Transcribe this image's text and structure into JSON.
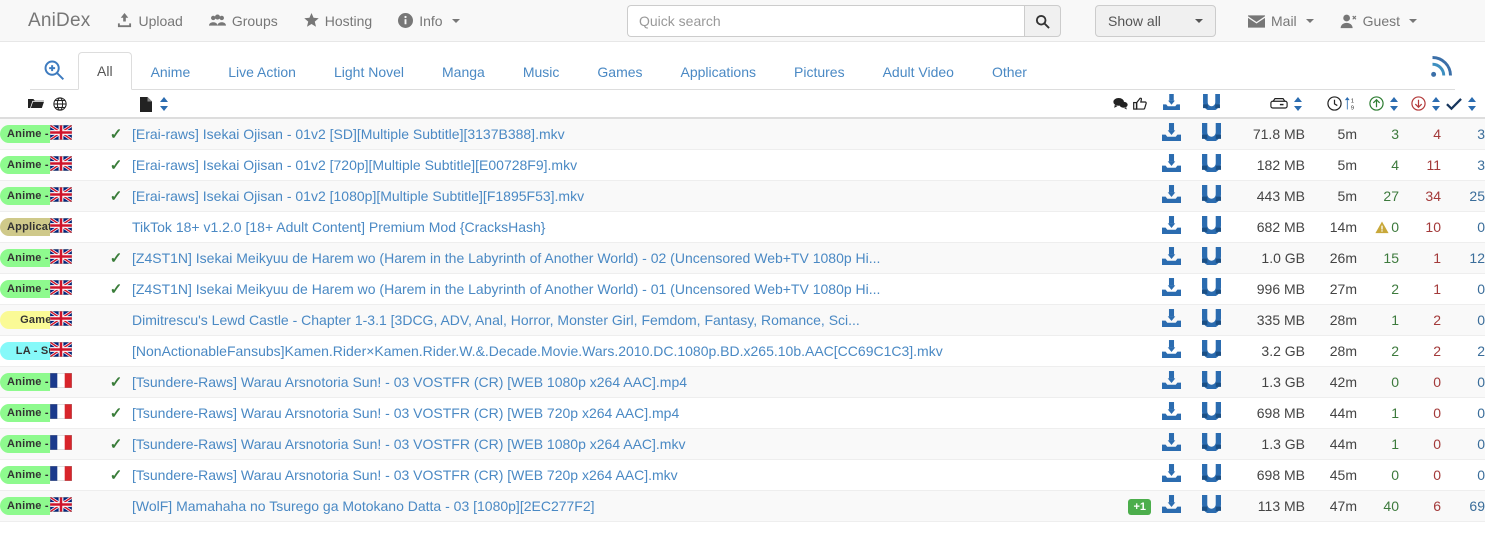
{
  "navbar": {
    "brand": "AniDex",
    "links": [
      {
        "label": "Upload",
        "icon": "upload-icon",
        "caret": false
      },
      {
        "label": "Groups",
        "icon": "users-icon",
        "caret": false
      },
      {
        "label": "Hosting",
        "icon": "star-icon",
        "caret": false
      },
      {
        "label": "Info",
        "icon": "info-icon",
        "caret": true
      }
    ],
    "search": {
      "placeholder": "Quick search",
      "value": "",
      "button_icon": "search-icon"
    },
    "filter": {
      "label": "Show all"
    },
    "right_links": [
      {
        "label": "Mail",
        "icon": "envelope-icon",
        "caret": true
      },
      {
        "label": "Guest",
        "icon": "user-icon",
        "caret": true
      }
    ]
  },
  "tabs": {
    "zoom_icon": "search-plus-icon",
    "rss_icon": "rss-icon",
    "items": [
      {
        "label": "All",
        "active": true
      },
      {
        "label": "Anime",
        "active": false
      },
      {
        "label": "Live Action",
        "active": false
      },
      {
        "label": "Light Novel",
        "active": false
      },
      {
        "label": "Manga",
        "active": false
      },
      {
        "label": "Music",
        "active": false
      },
      {
        "label": "Games",
        "active": false
      },
      {
        "label": "Applications",
        "active": false
      },
      {
        "label": "Pictures",
        "active": false
      },
      {
        "label": "Adult Video",
        "active": false
      },
      {
        "label": "Other",
        "active": false
      }
    ]
  },
  "table": {
    "headers": {
      "category_icon": "folder-open-icon",
      "language_icon": "globe-icon",
      "filename_icon": "file-icon",
      "comments_icon": "comments-icon",
      "likes_icon": "thumbs-up-icon",
      "download_icon": "download-icon",
      "magnet_icon": "magnet-icon",
      "size_icon": "hdd-icon",
      "age_icon": "clock-icon",
      "age_sort_icon": "sort-numeric-icon",
      "seeders_icon": "arrow-up-circle-icon",
      "leechers_icon": "arrow-down-circle-icon",
      "completed_icon": "check-icon"
    },
    "colors": {
      "anime_sub": "#8efa8e",
      "applications": "#cfc98a",
      "games": "#fafa96",
      "la_sub": "#86f9f9",
      "seeders": "#3d7a3d",
      "leechers": "#a33a3a",
      "completed": "#3a6d9a",
      "comment_badge": "#4cae4c",
      "link": "#4a89c4"
    },
    "rows": [
      {
        "category": "Anime - Sub",
        "cat_color": "#8efa8e",
        "flag": "gb",
        "verified": true,
        "title": "[Erai-raws] Isekai Ojisan - 01v2 [SD][Multiple Subtitle][3137B388].mkv",
        "comments": "",
        "size": "71.8 MB",
        "age": "5m",
        "seeders": "3",
        "leechers": "4",
        "completed": "3",
        "warning": false
      },
      {
        "category": "Anime - Sub",
        "cat_color": "#8efa8e",
        "flag": "gb",
        "verified": true,
        "title": "[Erai-raws] Isekai Ojisan - 01v2 [720p][Multiple Subtitle][E00728F9].mkv",
        "comments": "",
        "size": "182 MB",
        "age": "5m",
        "seeders": "4",
        "leechers": "11",
        "completed": "3",
        "warning": false
      },
      {
        "category": "Anime - Sub",
        "cat_color": "#8efa8e",
        "flag": "gb",
        "verified": true,
        "title": "[Erai-raws] Isekai Ojisan - 01v2 [1080p][Multiple Subtitle][F1895F53].mkv",
        "comments": "",
        "size": "443 MB",
        "age": "5m",
        "seeders": "27",
        "leechers": "34",
        "completed": "25",
        "warning": false
      },
      {
        "category": "Applications",
        "cat_color": "#cfc98a",
        "flag": "gb",
        "verified": false,
        "title": "TikTok 18+ v1.2.0 [18+ Adult Content] Premium Mod {CracksHash}",
        "comments": "",
        "size": "682 MB",
        "age": "14m",
        "seeders": "0",
        "leechers": "10",
        "completed": "0",
        "warning": true
      },
      {
        "category": "Anime - Sub",
        "cat_color": "#8efa8e",
        "flag": "gb",
        "verified": true,
        "title": "[Z4ST1N] Isekai Meikyuu de Harem wo (Harem in the Labyrinth of Another World) - 02 (Uncensored Web+TV 1080p Hi...",
        "comments": "",
        "size": "1.0 GB",
        "age": "26m",
        "seeders": "15",
        "leechers": "1",
        "completed": "12",
        "warning": false
      },
      {
        "category": "Anime - Sub",
        "cat_color": "#8efa8e",
        "flag": "gb",
        "verified": true,
        "title": "[Z4ST1N] Isekai Meikyuu de Harem wo (Harem in the Labyrinth of Another World) - 01 (Uncensored Web+TV 1080p Hi...",
        "comments": "",
        "size": "996 MB",
        "age": "27m",
        "seeders": "2",
        "leechers": "1",
        "completed": "0",
        "warning": false
      },
      {
        "category": "Games",
        "cat_color": "#fafa96",
        "flag": "gb",
        "verified": false,
        "title": "Dimitrescu's Lewd Castle - Chapter 1-3.1 [3DCG, ADV, Anal, Horror, Monster Girl, Femdom, Fantasy, Romance, Sci...",
        "comments": "",
        "size": "335 MB",
        "age": "28m",
        "seeders": "1",
        "leechers": "2",
        "completed": "0",
        "warning": false
      },
      {
        "category": "LA - Sub",
        "cat_color": "#86f9f9",
        "flag": "gb",
        "verified": false,
        "title": "[NonActionableFansubs]Kamen.Rider×Kamen.Rider.W.&.Decade.Movie.Wars.2010.DC.1080p.BD.x265.10b.AAC[CC69C1C3].mkv",
        "comments": "",
        "size": "3.2 GB",
        "age": "28m",
        "seeders": "2",
        "leechers": "2",
        "completed": "2",
        "warning": false
      },
      {
        "category": "Anime - Sub",
        "cat_color": "#8efa8e",
        "flag": "fr",
        "verified": true,
        "title": "[Tsundere-Raws] Warau Arsnotoria Sun! - 03 VOSTFR (CR) [WEB 1080p x264 AAC].mp4",
        "comments": "",
        "size": "1.3 GB",
        "age": "42m",
        "seeders": "0",
        "leechers": "0",
        "completed": "0",
        "warning": false
      },
      {
        "category": "Anime - Sub",
        "cat_color": "#8efa8e",
        "flag": "fr",
        "verified": true,
        "title": "[Tsundere-Raws] Warau Arsnotoria Sun! - 03 VOSTFR (CR) [WEB 720p x264 AAC].mp4",
        "comments": "",
        "size": "698 MB",
        "age": "44m",
        "seeders": "1",
        "leechers": "0",
        "completed": "0",
        "warning": false
      },
      {
        "category": "Anime - Sub",
        "cat_color": "#8efa8e",
        "flag": "fr",
        "verified": true,
        "title": "[Tsundere-Raws] Warau Arsnotoria Sun! - 03 VOSTFR (CR) [WEB 1080p x264 AAC].mkv",
        "comments": "",
        "size": "1.3 GB",
        "age": "44m",
        "seeders": "1",
        "leechers": "0",
        "completed": "0",
        "warning": false
      },
      {
        "category": "Anime - Sub",
        "cat_color": "#8efa8e",
        "flag": "fr",
        "verified": true,
        "title": "[Tsundere-Raws] Warau Arsnotoria Sun! - 03 VOSTFR (CR) [WEB 720p x264 AAC].mkv",
        "comments": "",
        "size": "698 MB",
        "age": "45m",
        "seeders": "0",
        "leechers": "0",
        "completed": "0",
        "warning": false
      },
      {
        "category": "Anime - Sub",
        "cat_color": "#8efa8e",
        "flag": "gb",
        "verified": false,
        "title": "[WolF] Mamahaha no Tsurego ga Motokano Datta - 03 [1080p][2EC277F2]",
        "comments": "+1",
        "size": "113 MB",
        "age": "47m",
        "seeders": "40",
        "leechers": "6",
        "completed": "69",
        "warning": false
      }
    ]
  }
}
